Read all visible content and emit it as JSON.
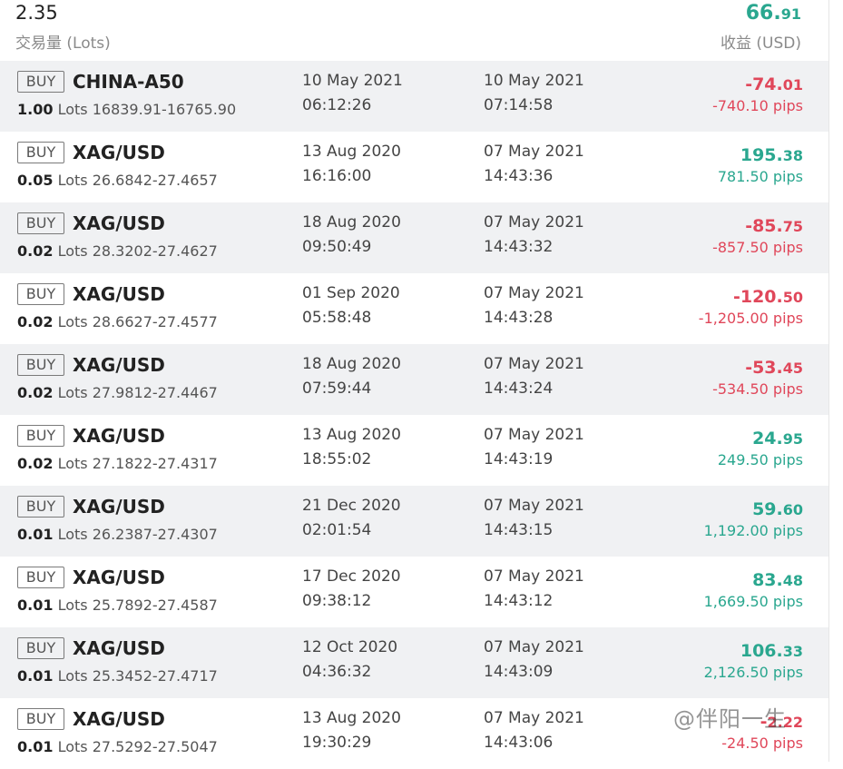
{
  "summary": {
    "volume_value": "2.35",
    "volume_label": "交易量 (Lots)",
    "profit_int": "66.",
    "profit_dec": "91",
    "profit_label": "收益 (USD)"
  },
  "common": {
    "side_label": "BUY",
    "lots_label": "Lots",
    "pips_suffix": "pips"
  },
  "trades": [
    {
      "symbol": "CHINA-A50",
      "lots": "1.00",
      "prices": "16839.91-16765.90",
      "open_date": "10 May 2021",
      "open_time": "06:12:26",
      "close_date": "10 May 2021",
      "close_time": "07:14:58",
      "profit_int": "-74.",
      "profit_dec": "01",
      "pips": "-740.10 pips",
      "positive": false
    },
    {
      "symbol": "XAG/USD",
      "lots": "0.05",
      "prices": "26.6842-27.4657",
      "open_date": "13 Aug 2020",
      "open_time": "16:16:00",
      "close_date": "07 May 2021",
      "close_time": "14:43:36",
      "profit_int": "195.",
      "profit_dec": "38",
      "pips": "781.50 pips",
      "positive": true
    },
    {
      "symbol": "XAG/USD",
      "lots": "0.02",
      "prices": "28.3202-27.4627",
      "open_date": "18 Aug 2020",
      "open_time": "09:50:49",
      "close_date": "07 May 2021",
      "close_time": "14:43:32",
      "profit_int": "-85.",
      "profit_dec": "75",
      "pips": "-857.50 pips",
      "positive": false
    },
    {
      "symbol": "XAG/USD",
      "lots": "0.02",
      "prices": "28.6627-27.4577",
      "open_date": "01 Sep 2020",
      "open_time": "05:58:48",
      "close_date": "07 May 2021",
      "close_time": "14:43:28",
      "profit_int": "-120.",
      "profit_dec": "50",
      "pips": "-1,205.00 pips",
      "positive": false
    },
    {
      "symbol": "XAG/USD",
      "lots": "0.02",
      "prices": "27.9812-27.4467",
      "open_date": "18 Aug 2020",
      "open_time": "07:59:44",
      "close_date": "07 May 2021",
      "close_time": "14:43:24",
      "profit_int": "-53.",
      "profit_dec": "45",
      "pips": "-534.50 pips",
      "positive": false
    },
    {
      "symbol": "XAG/USD",
      "lots": "0.02",
      "prices": "27.1822-27.4317",
      "open_date": "13 Aug 2020",
      "open_time": "18:55:02",
      "close_date": "07 May 2021",
      "close_time": "14:43:19",
      "profit_int": "24.",
      "profit_dec": "95",
      "pips": "249.50 pips",
      "positive": true
    },
    {
      "symbol": "XAG/USD",
      "lots": "0.01",
      "prices": "26.2387-27.4307",
      "open_date": "21 Dec 2020",
      "open_time": "02:01:54",
      "close_date": "07 May 2021",
      "close_time": "14:43:15",
      "profit_int": "59.",
      "profit_dec": "60",
      "pips": "1,192.00 pips",
      "positive": true
    },
    {
      "symbol": "XAG/USD",
      "lots": "0.01",
      "prices": "25.7892-27.4587",
      "open_date": "17 Dec 2020",
      "open_time": "09:38:12",
      "close_date": "07 May 2021",
      "close_time": "14:43:12",
      "profit_int": "83.",
      "profit_dec": "48",
      "pips": "1,669.50 pips",
      "positive": true
    },
    {
      "symbol": "XAG/USD",
      "lots": "0.01",
      "prices": "25.3452-27.4717",
      "open_date": "12 Oct 2020",
      "open_time": "04:36:32",
      "close_date": "07 May 2021",
      "close_time": "14:43:09",
      "profit_int": "106.",
      "profit_dec": "33",
      "pips": "2,126.50 pips",
      "positive": true
    },
    {
      "symbol": "XAG/USD",
      "lots": "0.01",
      "prices": "27.5292-27.5047",
      "open_date": "13 Aug 2020",
      "open_time": "19:30:29",
      "close_date": "07 May 2021",
      "close_time": "14:43:06",
      "profit_int": "-",
      "profit_dec": "2.22",
      "pips": "-24.50 pips",
      "positive": false
    }
  ],
  "watermark": "@伴阳一生",
  "colors": {
    "positive": "#2aa78f",
    "negative": "#e0475a",
    "row_alt_bg": "#f0f1f3"
  }
}
